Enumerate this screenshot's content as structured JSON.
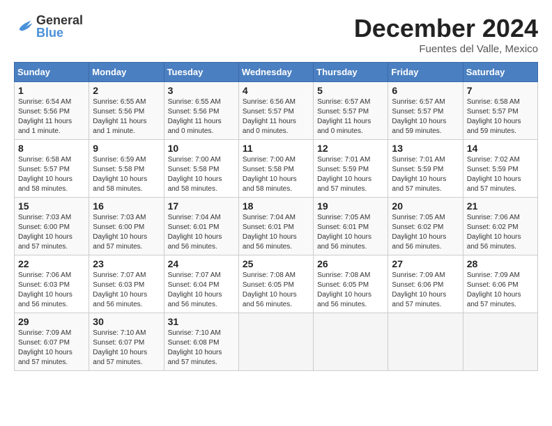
{
  "logo": {
    "general": "General",
    "blue": "Blue"
  },
  "title": "December 2024",
  "location": "Fuentes del Valle, Mexico",
  "days_header": [
    "Sunday",
    "Monday",
    "Tuesday",
    "Wednesday",
    "Thursday",
    "Friday",
    "Saturday"
  ],
  "weeks": [
    [
      {
        "day": "1",
        "sunrise": "6:54 AM",
        "sunset": "5:56 PM",
        "daylight": "11 hours and 1 minute."
      },
      {
        "day": "2",
        "sunrise": "6:55 AM",
        "sunset": "5:56 PM",
        "daylight": "11 hours and 1 minute."
      },
      {
        "day": "3",
        "sunrise": "6:55 AM",
        "sunset": "5:56 PM",
        "daylight": "11 hours and 0 minutes."
      },
      {
        "day": "4",
        "sunrise": "6:56 AM",
        "sunset": "5:57 PM",
        "daylight": "11 hours and 0 minutes."
      },
      {
        "day": "5",
        "sunrise": "6:57 AM",
        "sunset": "5:57 PM",
        "daylight": "11 hours and 0 minutes."
      },
      {
        "day": "6",
        "sunrise": "6:57 AM",
        "sunset": "5:57 PM",
        "daylight": "10 hours and 59 minutes."
      },
      {
        "day": "7",
        "sunrise": "6:58 AM",
        "sunset": "5:57 PM",
        "daylight": "10 hours and 59 minutes."
      }
    ],
    [
      {
        "day": "8",
        "sunrise": "6:58 AM",
        "sunset": "5:57 PM",
        "daylight": "10 hours and 58 minutes."
      },
      {
        "day": "9",
        "sunrise": "6:59 AM",
        "sunset": "5:58 PM",
        "daylight": "10 hours and 58 minutes."
      },
      {
        "day": "10",
        "sunrise": "7:00 AM",
        "sunset": "5:58 PM",
        "daylight": "10 hours and 58 minutes."
      },
      {
        "day": "11",
        "sunrise": "7:00 AM",
        "sunset": "5:58 PM",
        "daylight": "10 hours and 58 minutes."
      },
      {
        "day": "12",
        "sunrise": "7:01 AM",
        "sunset": "5:59 PM",
        "daylight": "10 hours and 57 minutes."
      },
      {
        "day": "13",
        "sunrise": "7:01 AM",
        "sunset": "5:59 PM",
        "daylight": "10 hours and 57 minutes."
      },
      {
        "day": "14",
        "sunrise": "7:02 AM",
        "sunset": "5:59 PM",
        "daylight": "10 hours and 57 minutes."
      }
    ],
    [
      {
        "day": "15",
        "sunrise": "7:03 AM",
        "sunset": "6:00 PM",
        "daylight": "10 hours and 57 minutes."
      },
      {
        "day": "16",
        "sunrise": "7:03 AM",
        "sunset": "6:00 PM",
        "daylight": "10 hours and 57 minutes."
      },
      {
        "day": "17",
        "sunrise": "7:04 AM",
        "sunset": "6:01 PM",
        "daylight": "10 hours and 56 minutes."
      },
      {
        "day": "18",
        "sunrise": "7:04 AM",
        "sunset": "6:01 PM",
        "daylight": "10 hours and 56 minutes."
      },
      {
        "day": "19",
        "sunrise": "7:05 AM",
        "sunset": "6:01 PM",
        "daylight": "10 hours and 56 minutes."
      },
      {
        "day": "20",
        "sunrise": "7:05 AM",
        "sunset": "6:02 PM",
        "daylight": "10 hours and 56 minutes."
      },
      {
        "day": "21",
        "sunrise": "7:06 AM",
        "sunset": "6:02 PM",
        "daylight": "10 hours and 56 minutes."
      }
    ],
    [
      {
        "day": "22",
        "sunrise": "7:06 AM",
        "sunset": "6:03 PM",
        "daylight": "10 hours and 56 minutes."
      },
      {
        "day": "23",
        "sunrise": "7:07 AM",
        "sunset": "6:03 PM",
        "daylight": "10 hours and 56 minutes."
      },
      {
        "day": "24",
        "sunrise": "7:07 AM",
        "sunset": "6:04 PM",
        "daylight": "10 hours and 56 minutes."
      },
      {
        "day": "25",
        "sunrise": "7:08 AM",
        "sunset": "6:05 PM",
        "daylight": "10 hours and 56 minutes."
      },
      {
        "day": "26",
        "sunrise": "7:08 AM",
        "sunset": "6:05 PM",
        "daylight": "10 hours and 56 minutes."
      },
      {
        "day": "27",
        "sunrise": "7:09 AM",
        "sunset": "6:06 PM",
        "daylight": "10 hours and 57 minutes."
      },
      {
        "day": "28",
        "sunrise": "7:09 AM",
        "sunset": "6:06 PM",
        "daylight": "10 hours and 57 minutes."
      }
    ],
    [
      {
        "day": "29",
        "sunrise": "7:09 AM",
        "sunset": "6:07 PM",
        "daylight": "10 hours and 57 minutes."
      },
      {
        "day": "30",
        "sunrise": "7:10 AM",
        "sunset": "6:07 PM",
        "daylight": "10 hours and 57 minutes."
      },
      {
        "day": "31",
        "sunrise": "7:10 AM",
        "sunset": "6:08 PM",
        "daylight": "10 hours and 57 minutes."
      },
      null,
      null,
      null,
      null
    ]
  ],
  "labels": {
    "sunrise": "Sunrise: ",
    "sunset": "Sunset: ",
    "daylight": "Daylight hours"
  }
}
